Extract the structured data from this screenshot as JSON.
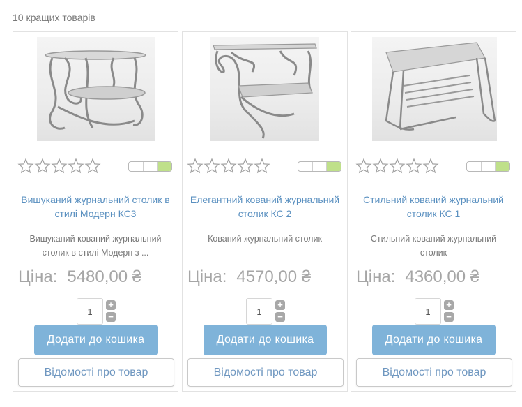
{
  "section": {
    "title": "10 кращих товарів"
  },
  "colors": {
    "title_link": "#5a90c0",
    "add_to_cart_bg": "#7fb3d9",
    "stock_on": "#bfe08a",
    "price_text": "#a6a6a6"
  },
  "products": [
    {
      "image_icon": "table-photo",
      "rating": 0,
      "rating_max": 5,
      "stock_level": 1,
      "stock_segments": 3,
      "title": "Вишуканий журнальний столик в стилі Модерн КС3",
      "description": "Вишуканий кований журнальний столик в стилі Модерн з ...",
      "price_label": "Ціна:",
      "price": "5480,00 ₴",
      "quantity": "1",
      "plus_label": "+",
      "minus_label": "−",
      "add_to_cart_label": "Додати до кошика",
      "details_label": "Відомості про товар"
    },
    {
      "image_icon": "table-photo",
      "rating": 0,
      "rating_max": 5,
      "stock_level": 1,
      "stock_segments": 3,
      "title": "Елегантний кований журнальний столик КС 2",
      "description": "Кований журнальний столик",
      "price_label": "Ціна:",
      "price": "4570,00 ₴",
      "quantity": "1",
      "plus_label": "+",
      "minus_label": "−",
      "add_to_cart_label": "Додати до кошика",
      "details_label": "Відомості про товар"
    },
    {
      "image_icon": "table-photo",
      "rating": 0,
      "rating_max": 5,
      "stock_level": 1,
      "stock_segments": 3,
      "title": "Стильний кований журнальний столик КС 1",
      "description": "Стильний кований журнальний столик",
      "price_label": "Ціна:",
      "price": "4360,00 ₴",
      "quantity": "1",
      "plus_label": "+",
      "minus_label": "−",
      "add_to_cart_label": "Додати до кошика",
      "details_label": "Відомості про товар"
    }
  ]
}
